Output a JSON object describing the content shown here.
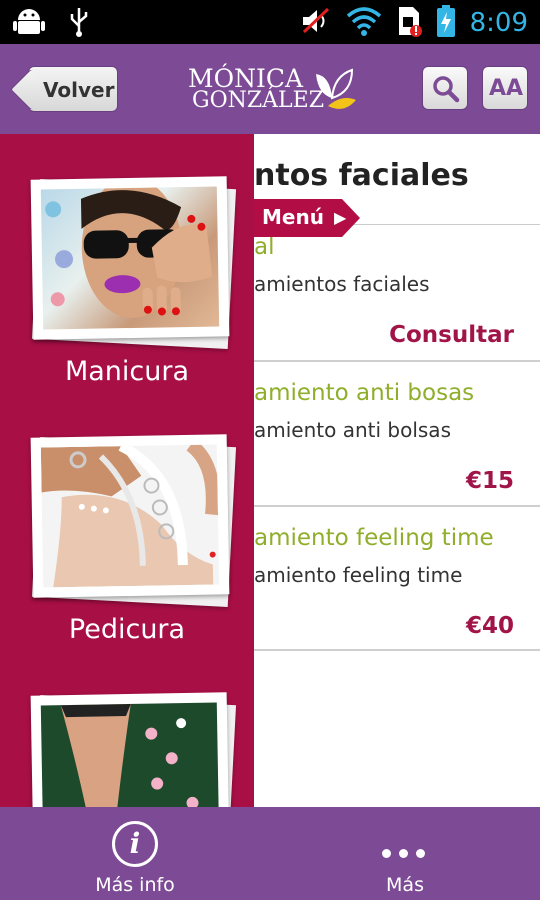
{
  "status_bar": {
    "time": "8:09",
    "icons": [
      "android-icon",
      "usb-icon",
      "mute-icon",
      "wifi-icon",
      "sim-alert-icon",
      "battery-charging-icon"
    ]
  },
  "header": {
    "back_label": "Volver",
    "logo_line1": "MÓNICA",
    "logo_line2": "GONZÁLEZ",
    "font_button_label": "AA",
    "colors": {
      "header": "#7d4b95",
      "sidebar": "#a80f45",
      "accent_green": "#8fae2b",
      "price": "#a01448"
    }
  },
  "main": {
    "title": "ntos faciales",
    "menu_tab_label": "Menú",
    "items": [
      {
        "title": "al",
        "description": "amientos faciales",
        "price": "Consultar"
      },
      {
        "title": "amiento anti bosas",
        "description": "amiento anti bolsas",
        "price": "€15"
      },
      {
        "title": "amiento feeling time",
        "description": "amiento feeling time",
        "price": "€40"
      }
    ]
  },
  "sidebar": {
    "categories": [
      {
        "label": "Manicura"
      },
      {
        "label": "Pedicura"
      },
      {
        "label": ""
      }
    ]
  },
  "bottom_bar": {
    "tabs": [
      {
        "label": "Más info"
      },
      {
        "label": "Más"
      }
    ]
  }
}
